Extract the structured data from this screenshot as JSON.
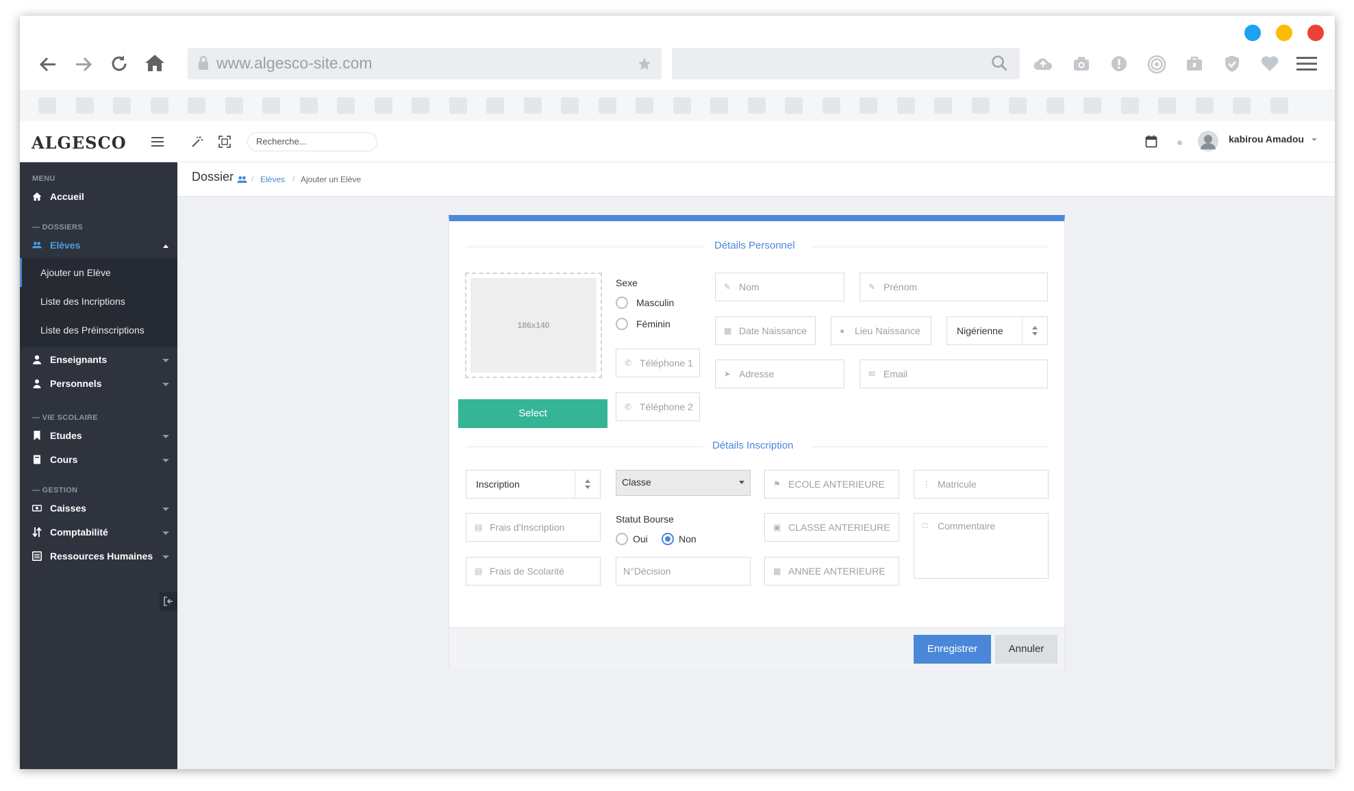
{
  "browser": {
    "url": "www.algesco-site.com",
    "window_controls": [
      "#1da1f2",
      "#fbbc05",
      "#ea4335"
    ]
  },
  "app": {
    "logo": "ALGESCO",
    "search_placeholder": "Recherche...",
    "user_name": "kabirou Amadou"
  },
  "breadcrumb": {
    "title": "Dossier",
    "eleves": "Elèves",
    "current": "Ajouter un Elève"
  },
  "sidebar": {
    "menu": "MENU",
    "accueil": "Accueil",
    "dossiers": "— DOSSIERS",
    "eleves": "Elèves",
    "sub_items": [
      "Ajouter un Elève",
      "Liste des Incriptions",
      "Liste des Préinscriptions"
    ],
    "enseignants": "Enseignants",
    "personnels": "Personnels",
    "vie_scolaire": "— VIE SCOLAIRE",
    "etudes": "Etudes",
    "cours": "Cours",
    "gestion": "— GESTION",
    "caisses": "Caisses",
    "comptabilite": "Comptabilité",
    "rh": "Ressources Humaines"
  },
  "form": {
    "section_personnel": "Détails Personnel",
    "photo_placeholder": "186x140",
    "select_button": "Select",
    "sexe_label": "Sexe",
    "masculin": "Masculin",
    "feminin": "Féminin",
    "telephone1": "Téléphone 1",
    "telephone2": "Téléphone 2",
    "nom": "Nom",
    "prenom": "Prénom",
    "date_naissance": "Date Naissance",
    "lieu_naissance": "Lieu Naissance",
    "nationalite": "Nigérienne",
    "adresse": "Adresse",
    "email": "Email",
    "section_inscription": "Détails Inscription",
    "inscription": "Inscription",
    "classe": "Classe",
    "ecole_anterieure": "ECOLE ANTERIEURE",
    "matricule": "Matricule",
    "frais_inscription": "Frais d'Inscription",
    "statut_bourse": "Statut Bourse",
    "oui": "Oui",
    "non": "Non",
    "classe_anterieure": "CLASSE ANTERIEURE",
    "commentaire": "Commentaire",
    "frais_scolarite": "Frais de Scolarité",
    "n_decision": "N°Décision",
    "annee_anterieure": "ANNEE ANTERIEURE",
    "save": "Enregistrer",
    "cancel": "Annuler"
  }
}
